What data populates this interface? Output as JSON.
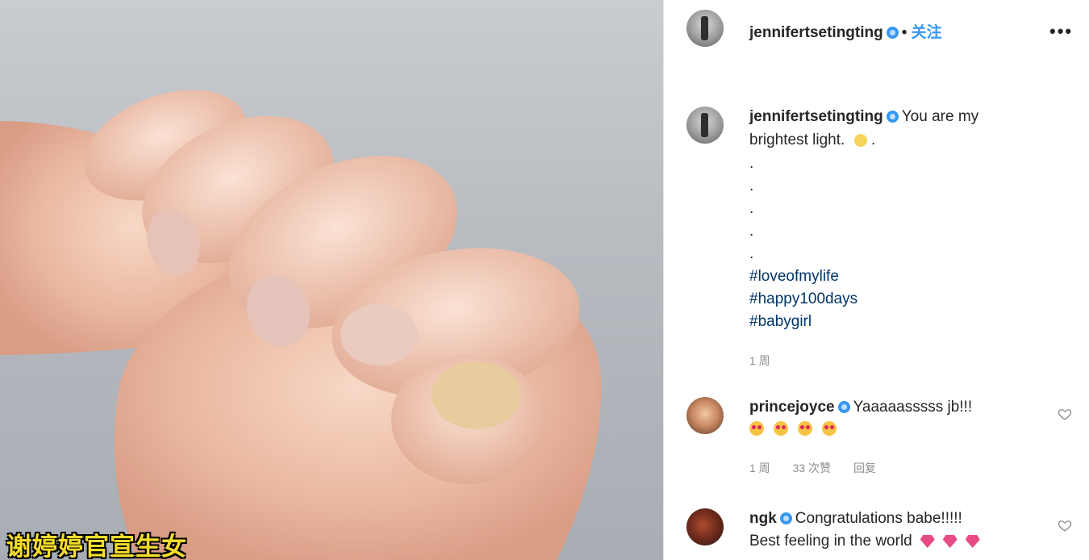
{
  "header": {
    "username": "jennifertsetingting",
    "follow_label": "关注",
    "more_label": "•••"
  },
  "post": {
    "username": "jennifertsetingting",
    "caption_line1": "You are my",
    "caption_line2": "brightest light.",
    "dots": [
      ".",
      ".",
      ".",
      ".",
      "."
    ],
    "hashtags": [
      "#loveofmylife",
      "#happy100days",
      "#babygirl"
    ],
    "time": "1 周"
  },
  "comments": [
    {
      "username": "princejoyce",
      "text": "Yaaaaasssss jb!!!",
      "meta_time": "1 周",
      "meta_likes": "33 次赞",
      "meta_reply": "回复"
    },
    {
      "username": "ngk",
      "line1": "Congratulations babe!!!!!",
      "line2": "Best feeling in the world"
    }
  ],
  "overlay": {
    "caption": "谢婷婷官宣生女"
  },
  "icons": {
    "verified": "verified-badge-icon",
    "heart": "heart-icon",
    "more": "more-options-icon"
  },
  "colors": {
    "link": "#3897f0",
    "hashtag": "#003569",
    "caption_yellow": "#f3dc2a"
  }
}
